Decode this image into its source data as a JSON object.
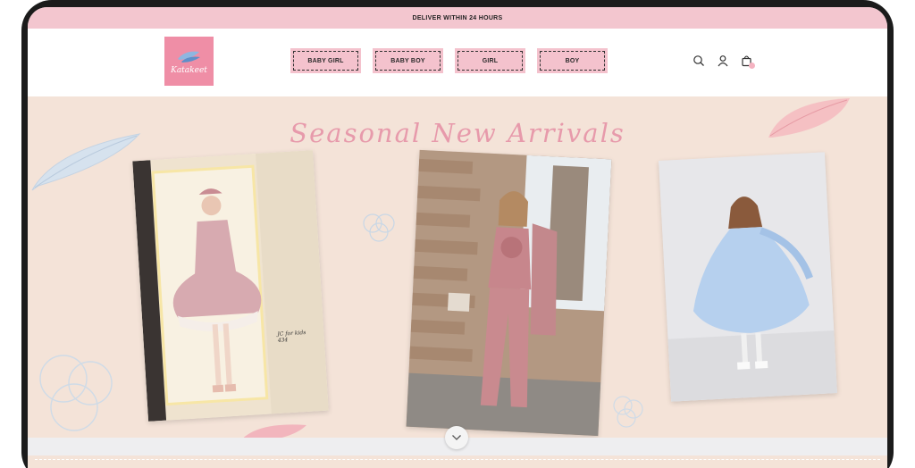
{
  "announcement": {
    "text": "DELIVER WITHIN 24 HOURS"
  },
  "brand": {
    "name": "Katakeet",
    "logo_color": "#ef8ea6"
  },
  "nav": {
    "items": [
      {
        "label": "BABY GIRL"
      },
      {
        "label": "BABY BOY"
      },
      {
        "label": "GIRL"
      },
      {
        "label": "BOY"
      }
    ]
  },
  "header_icons": [
    "search-icon",
    "account-icon",
    "cart-icon"
  ],
  "hero": {
    "title": "Seasonal New Arrivals",
    "photos": [
      {
        "subject": "girl in pink ball dress",
        "caption_line1": "JC for kids",
        "caption_line2": "434"
      },
      {
        "subject": "girl in pink jumpsuit"
      },
      {
        "subject": "girl in light blue dress"
      }
    ]
  },
  "colors": {
    "announcement_bg": "#f3c6cf",
    "nav_bg": "#f4c2cd",
    "hero_bg": "#f4e3d8",
    "title_color": "#e79aab"
  }
}
